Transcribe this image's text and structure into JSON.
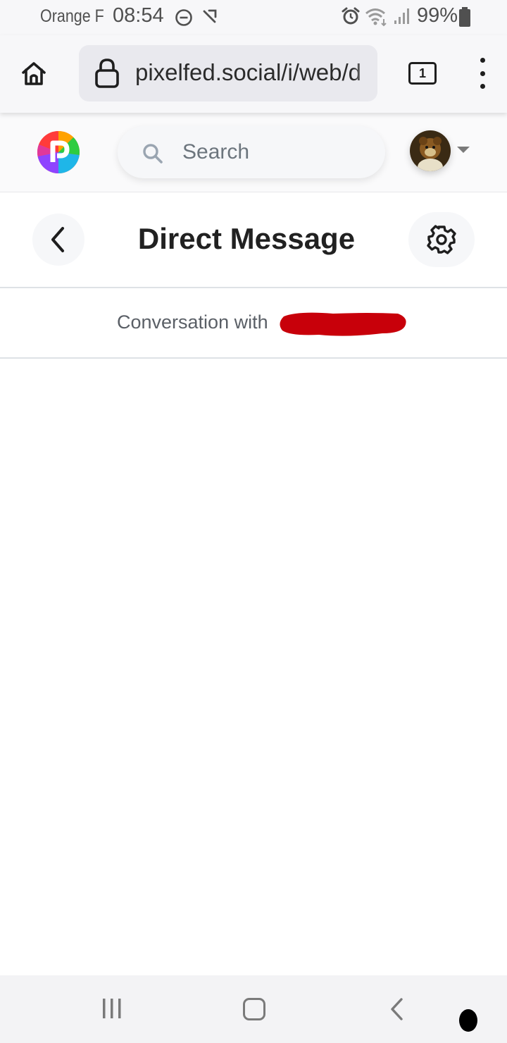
{
  "status_bar": {
    "carrier": "Orange F",
    "time": "08:54",
    "battery": "99%",
    "icons": [
      "do-not-disturb-icon",
      "missed-call-icon",
      "alarm-icon",
      "wifi-icon",
      "signal-icon",
      "battery-icon"
    ]
  },
  "browser": {
    "url": "pixelfed.social/i/web/d",
    "tab_count": "1",
    "icons": [
      "home-icon",
      "lock-icon",
      "tabs-icon",
      "more-vertical-icon"
    ]
  },
  "app_nav": {
    "search_placeholder": "Search",
    "icons": [
      "pixelfed-logo",
      "search-icon",
      "chevron-down-icon"
    ]
  },
  "dm": {
    "title": "Direct Message",
    "conversation_label": "Conversation with",
    "icons": [
      "chevron-left-icon",
      "gear-icon"
    ]
  },
  "android_nav": {
    "icons": [
      "recents-icon",
      "home-icon",
      "back-icon"
    ]
  },
  "colors": {
    "redaction": "#c8000a",
    "bar_background": "#f7f7f9",
    "divider": "#dee2e6"
  }
}
